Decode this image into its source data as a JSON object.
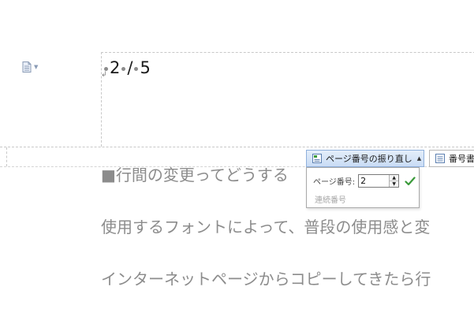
{
  "header": {
    "page_current": "2",
    "page_separator": "/",
    "page_total": "5",
    "paragraph_mark": "↲"
  },
  "toolbar": {
    "renumber_label": "ページ番号の振り直し",
    "number_label": "番号書"
  },
  "renumber_panel": {
    "page_number_label": "ページ番号:",
    "page_number_value": "2",
    "continuous_label": "連続番号"
  },
  "body": {
    "line1": "■行間の変更ってどうする",
    "line2": "使用するフォントによって、普段の使用感と変",
    "line3": "インターネットページからコピーしてきたら行"
  },
  "colors": {
    "accent_check": "#3a9a3a",
    "button_highlight": "#c9dcf5",
    "body_text": "#8c8c8c"
  },
  "icons": {
    "header_doc": "document-icon",
    "renumber": "page-number-icon",
    "confirm": "checkmark-icon"
  }
}
